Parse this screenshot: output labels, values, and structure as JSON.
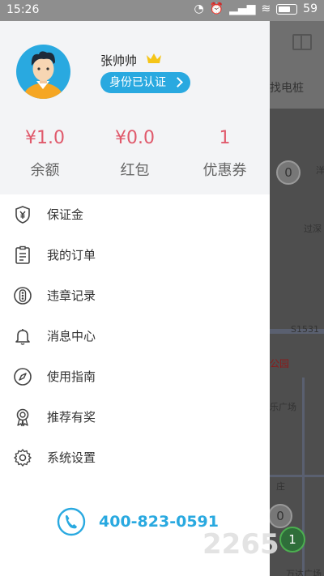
{
  "status_bar": {
    "time": "15:26",
    "battery": "59"
  },
  "profile": {
    "name": "张帅帅",
    "verify_label": "身份已认证"
  },
  "stats": [
    {
      "value": "¥1.0",
      "label": "余额"
    },
    {
      "value": "¥0.0",
      "label": "红包"
    },
    {
      "value": "1",
      "label": "优惠券"
    }
  ],
  "menu": [
    {
      "label": "保证金",
      "icon": "shield-yen-icon"
    },
    {
      "label": "我的订单",
      "icon": "clipboard-icon"
    },
    {
      "label": "违章记录",
      "icon": "traffic-light-icon"
    },
    {
      "label": "消息中心",
      "icon": "bell-icon"
    },
    {
      "label": "使用指南",
      "icon": "compass-icon"
    },
    {
      "label": "推荐有奖",
      "icon": "award-icon"
    },
    {
      "label": "系统设置",
      "icon": "gear-icon"
    }
  ],
  "hotline": {
    "number": "400-823-0591"
  },
  "map": {
    "top_text": "找电桩",
    "labels": [
      "洋",
      "过深",
      "S1531",
      "公园",
      "乐广场",
      "庄",
      "万达广场"
    ],
    "pins": [
      "0",
      "0",
      "1"
    ]
  },
  "watermark": "2265",
  "colors": {
    "accent": "#29a9e0",
    "price": "#e05a6c"
  }
}
